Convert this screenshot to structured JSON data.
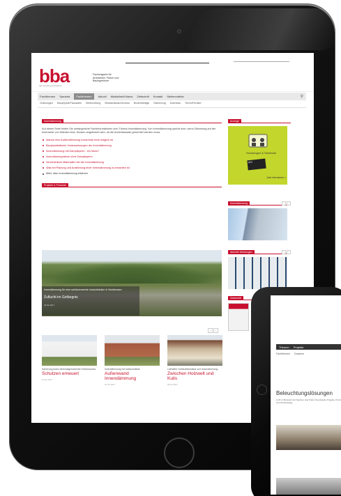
{
  "site": {
    "logo": "bba",
    "logo_sub": "bau beratung architektur",
    "tagline": "Fachmagazin für Architekten, Planer und Bauingenieure"
  },
  "nav": {
    "items": [
      "Fachthemen",
      "Spezials",
      "Fachthemen",
      "Aktuell",
      "Mediathek/Videos",
      "Zeitschrift",
      "Kontakt",
      "Stellenmärkte"
    ],
    "active_index": 2
  },
  "subnav": {
    "items": [
      "Grabungen",
      "Bauphysik/Fassaden",
      "Beleuchtung",
      "Bestandsbau/Umbau",
      "Bodenbeläge",
      "Dämmung",
      "Dachbau",
      "Türen/Fenster"
    ]
  },
  "main": {
    "section_label": "Innendämmung",
    "intro": "Auf dieser Seite finden Sie umfangreiche Fachinformationen zum Thema Innendämmung. Von Innendämmung spricht man, wenn Dämmung auf der Innenseite von Wänden bzw. Decken angebracht wird, da die Außenfassade geschützt werden muss.",
    "bullets": [
      "Warum eine Außendämmung manchmal nicht möglich ist",
      "Bauphysikalische Voraussetzungen der Innendämmung",
      "Innendämmung mit Dampfsperre - ein Muss?",
      "Innendämmsysteme ohne Dampfsperre",
      "Verschiedene Materialien bei der Innendämmung",
      "Was bei Planung und Ausführung einer Innendämmung zu beachten ist"
    ],
    "more": "Mehr über Innendämmung erfahren",
    "featured_label": "Projekte & Produkte",
    "featured_caption": "Innendämmung für eine schützenswerte Industriekultur in Nordhessen",
    "featured_title": "Zuflucht im Gefängnis",
    "featured_date": "24.01.2017",
    "cards": [
      {
        "small": "Sanierung eines denkmalgeschützten Wohnhauses",
        "title": "Schutzen erneuert",
        "date": "10.01.2017"
      },
      {
        "small": "Innendämmung mit Kalziumsilikat",
        "title": "Außenwand Innendämmung",
        "date": "07.01.2017"
      },
      {
        "small": "Lebhafter Gebäudebestand und Innendämmung",
        "title": "Zwischen Holzwelt und Kulis",
        "date": "05.01.2017"
      }
    ]
  },
  "sidebar": {
    "advert_label": "Anzeige",
    "advert_title": "Schulungen & Seminare",
    "advert_badge": "NEU",
    "advert_button": "Jetzt informieren >",
    "block2_label": "Innendämmung",
    "block3_label": "Aktuelle Meldungen",
    "block4_label": "Zeitschrift"
  },
  "phone": {
    "nav": [
      "Themen",
      "Projekte"
    ],
    "sub": [
      "Fachthemen",
      "Dossiers"
    ],
    "title": "Beleuchtungslösungen",
    "text": "Licht im Bestand und Neubau: Hier finden Sie aktuelle Projekte, Produkte und Fachbeiträge."
  },
  "colors": {
    "brand": "#c8102e",
    "advert": "#c3d62b"
  }
}
